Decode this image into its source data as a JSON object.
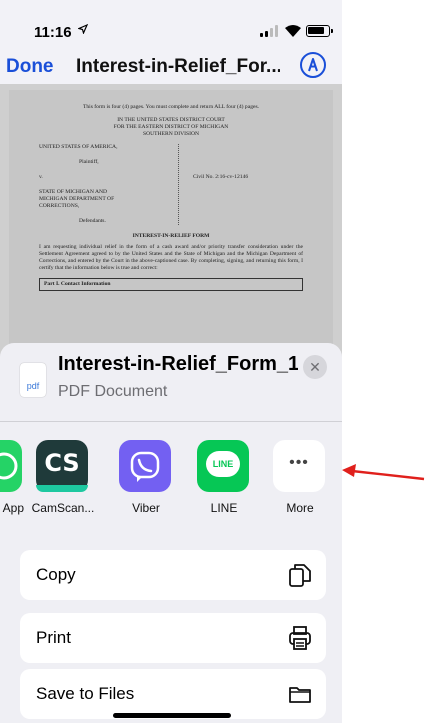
{
  "status": {
    "time": "11:16"
  },
  "nav": {
    "done": "Done",
    "title": "Interest-in-Relief_For..."
  },
  "document": {
    "notice": "This form is four (4) pages. You must complete and return ALL four (4) pages.",
    "court_line1": "IN THE UNITED STATES DISTRICT COURT",
    "court_line2": "FOR THE EASTERN DISTRICT OF MICHIGAN",
    "court_line3": "SOUTHERN DIVISION",
    "plaintiff_name": "UNITED STATES OF AMERICA,",
    "plaintiff_label": "Plaintiff,",
    "v": "v.",
    "defendant_name": "STATE OF MICHIGAN AND MICHIGAN DEPARTMENT OF CORRECTIONS,",
    "defendant_label": "Defendants.",
    "civil_no": "Civil No. 2:16-cv-12146",
    "form_title": "INTEREST-IN-RELIEF FORM",
    "paragraph": "I am requesting individual relief in the form of a cash award and/or priority transfer consideration under the Settlement Agreement agreed to by the United States and the State of Michigan and the Michigan Department of Corrections, and entered by the Court in the above-captioned case. By completing, signing, and returning this form, I certify that the information below is true and correct:",
    "part1": "Part I. Contact Information"
  },
  "share": {
    "file_name": "Interest-in-Relief_Form_1...",
    "file_type": "PDF Document",
    "file_icon_label": "pdf",
    "close": "✕",
    "apps": [
      {
        "label": "App",
        "color": "#25d366"
      },
      {
        "label": "CamScan...",
        "color": "#1f3a3a",
        "glyph": "CS"
      },
      {
        "label": "Viber",
        "color": "#7360f2"
      },
      {
        "label": "LINE",
        "color": "#06c755",
        "glyph": "LINE"
      },
      {
        "label": "More",
        "glyph": "•••"
      }
    ],
    "actions": [
      {
        "label": "Copy",
        "icon": "copy-icon"
      },
      {
        "label": "Print",
        "icon": "printer-icon"
      },
      {
        "label": "Save to Files",
        "icon": "folder-icon"
      }
    ]
  },
  "annotation": {
    "arrow_color": "#e0201c"
  }
}
